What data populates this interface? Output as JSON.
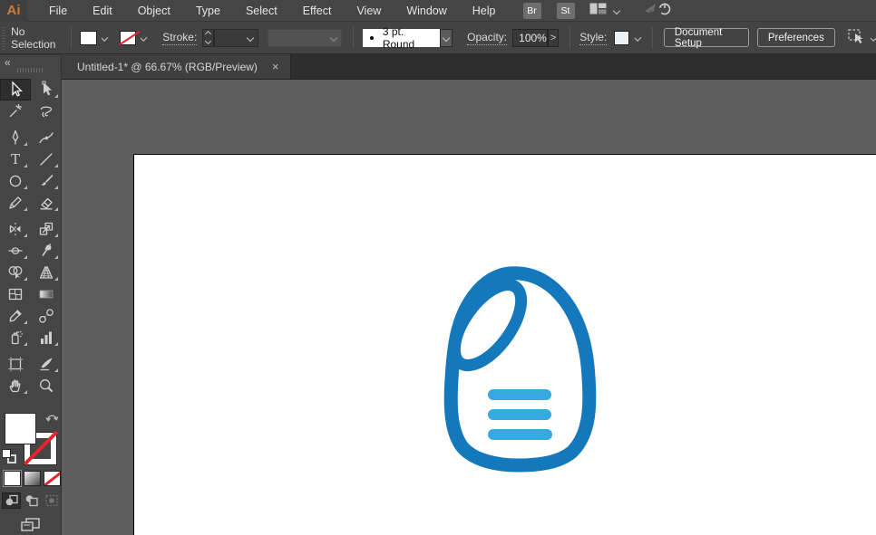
{
  "app": {
    "logo_text": "Ai"
  },
  "menubar": {
    "items": [
      "File",
      "Edit",
      "Object",
      "Type",
      "Select",
      "Effect",
      "View",
      "Window",
      "Help"
    ],
    "brushes_panel_label": "Br",
    "graphic_styles_panel_label": "St",
    "workspace_switcher_icon": "workspace-layout-icon",
    "gpu_performance_icon": "rocket-power-icon"
  },
  "control_bar": {
    "selection_status": "No Selection",
    "fill_swatch": "white",
    "stroke_swatch": "none",
    "stroke_label": "Stroke:",
    "brush_definition": "3 pt. Round",
    "opacity_label": "Opacity:",
    "opacity_value": "100%",
    "style_label": "Style:",
    "document_setup_label": "Document Setup",
    "preferences_label": "Preferences",
    "more_options_arrow": ">"
  },
  "document_tab": {
    "title": "Untitled-1* @ 66.67% (RGB/Preview)",
    "close_glyph": "×"
  },
  "toolbar": {
    "collapse_glyph": "«",
    "tools": [
      {
        "name": "selection-tool",
        "selected": true,
        "flyout": false
      },
      {
        "name": "direct-selection-tool",
        "selected": false,
        "flyout": true
      },
      {
        "name": "magic-wand-tool",
        "selected": false,
        "flyout": false
      },
      {
        "name": "lasso-tool",
        "selected": false,
        "flyout": false
      },
      {
        "name": "pen-tool",
        "selected": false,
        "flyout": true
      },
      {
        "name": "curvature-tool",
        "selected": false,
        "flyout": false
      },
      {
        "name": "type-tool",
        "selected": false,
        "flyout": true
      },
      {
        "name": "line-segment-tool",
        "selected": false,
        "flyout": true
      },
      {
        "name": "ellipse-tool",
        "selected": false,
        "flyout": true
      },
      {
        "name": "paintbrush-tool",
        "selected": false,
        "flyout": true
      },
      {
        "name": "pencil-tool",
        "selected": false,
        "flyout": true
      },
      {
        "name": "eraser-tool",
        "selected": false,
        "flyout": true
      },
      {
        "name": "reflect-tool",
        "selected": false,
        "flyout": true
      },
      {
        "name": "scale-tool",
        "selected": false,
        "flyout": true
      },
      {
        "name": "width-tool",
        "selected": false,
        "flyout": true
      },
      {
        "name": "puppet-warp-tool",
        "selected": false,
        "flyout": true
      },
      {
        "name": "shape-builder-tool",
        "selected": false,
        "flyout": true
      },
      {
        "name": "perspective-grid-tool",
        "selected": false,
        "flyout": true
      },
      {
        "name": "mesh-tool",
        "selected": false,
        "flyout": false
      },
      {
        "name": "gradient-tool",
        "selected": false,
        "flyout": false
      },
      {
        "name": "eyedropper-tool",
        "selected": false,
        "flyout": true
      },
      {
        "name": "blend-tool",
        "selected": false,
        "flyout": false
      },
      {
        "name": "symbol-sprayer-tool",
        "selected": false,
        "flyout": true
      },
      {
        "name": "column-graph-tool",
        "selected": false,
        "flyout": true
      },
      {
        "name": "artboard-tool",
        "selected": false,
        "flyout": false
      },
      {
        "name": "slice-tool",
        "selected": false,
        "flyout": true
      },
      {
        "name": "hand-tool",
        "selected": false,
        "flyout": true
      },
      {
        "name": "zoom-tool",
        "selected": false,
        "flyout": false
      }
    ],
    "fill_proxy": "white",
    "stroke_proxy": "none",
    "color_mode_buttons": [
      "color",
      "gradient",
      "none"
    ],
    "drawing_modes": [
      {
        "name": "draw-normal",
        "state": "selected"
      },
      {
        "name": "draw-behind",
        "state": "normal"
      },
      {
        "name": "draw-inside",
        "state": "disabled"
      }
    ],
    "screen_mode_icon": "screen-mode-icon"
  },
  "canvas": {
    "artboard": "white",
    "logo": {
      "description": "blue detergent-bottle logo with oval handle hole and three text bars"
    }
  },
  "colors": {
    "app_logo_orange": "#cb7b38",
    "none_slash_red": "#e2262b",
    "logo_outline": "#1478bd",
    "logo_bars": "#36a9e1"
  }
}
